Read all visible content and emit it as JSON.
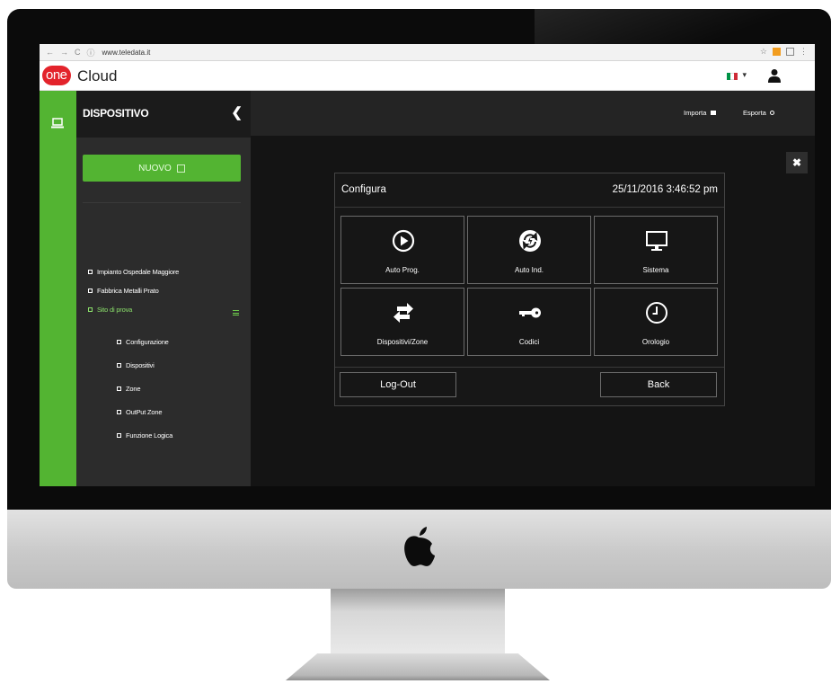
{
  "browser": {
    "url": "www.teledata.it",
    "back_glyph": "←",
    "forward_glyph": "→",
    "reload_glyph": "C",
    "info_glyph": "ⓘ",
    "star_glyph": "☆",
    "menu_glyph": "⋮"
  },
  "app": {
    "logo_part1": "one",
    "logo_part2": "Cloud",
    "language_caret": "▾",
    "colors": {
      "brand_red": "#e3232b",
      "green": "#53b432",
      "flag": [
        "#009246",
        "#ffffff",
        "#ce2b37"
      ]
    }
  },
  "sidebar": {
    "title": "DISPOSITIVO",
    "collapse_glyph": "❮",
    "new_button": "NUOVO",
    "tree": [
      {
        "label": "Impianto Ospedale Maggiore",
        "active": false
      },
      {
        "label": "Fabbrica Metalli Prato",
        "active": false
      },
      {
        "label": "Sito di prova",
        "active": true
      }
    ],
    "subtree": [
      {
        "label": "Configurazione"
      },
      {
        "label": "Dispositivi"
      },
      {
        "label": "Zone"
      },
      {
        "label": "OutPut Zone"
      },
      {
        "label": "Funzione Logica"
      }
    ]
  },
  "topbar": {
    "import_label": "Importa",
    "export_label": "Esporta",
    "close_glyph": "✖"
  },
  "panel": {
    "title": "Configura",
    "datetime": "25/11/2016 3:46:52 pm",
    "tiles": [
      {
        "label": "Auto Prog.",
        "icon": "play-circle-icon"
      },
      {
        "label": "Auto Ind.",
        "icon": "sync-circle-icon"
      },
      {
        "label": "Sistema",
        "icon": "monitor-icon"
      },
      {
        "label": "Dispositivi/Zone",
        "icon": "swap-arrows-icon"
      },
      {
        "label": "Codici",
        "icon": "key-icon"
      },
      {
        "label": "Orologio",
        "icon": "clock-icon"
      }
    ],
    "logout_label": "Log-Out",
    "back_label": "Back"
  }
}
